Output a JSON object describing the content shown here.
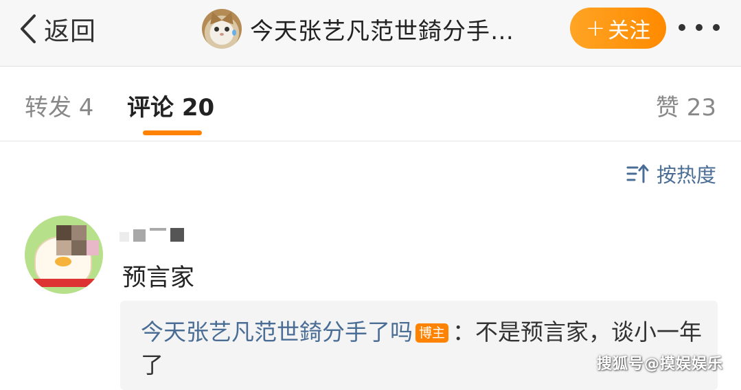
{
  "header": {
    "back_label": "返回",
    "title": "今天张艺凡范世錡分手…",
    "follow_label": "关注"
  },
  "tabs": {
    "forward": "转发 4",
    "comment": "评论 20",
    "like": "赞 23"
  },
  "sort": {
    "label": "按热度"
  },
  "comment": {
    "text": "预言家",
    "reply": {
      "author": "今天张艺凡范世錡分手了吗",
      "badge": "博主",
      "text": "：不是预言家，谈小一年了"
    }
  },
  "watermark": "搜狐号@摸娱娱乐",
  "colors": {
    "accent": "#ff8200",
    "link": "#4a6d96"
  },
  "icons": {
    "back": "chevron-left-icon",
    "more": "more-dots-icon",
    "sort": "sort-icon"
  }
}
